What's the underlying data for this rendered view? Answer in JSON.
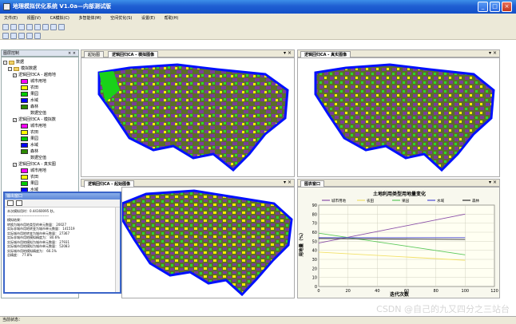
{
  "window": {
    "title": "地理模拟优化系统 V1.0a—内部测试版"
  },
  "menu": [
    "文件(E)",
    "视图(V)",
    "CA模拟(C)",
    "多智能体(M)",
    "空间优化(S)",
    "设置(E)",
    "帮助(H)"
  ],
  "layer_panel": {
    "header": "图层控制",
    "root": "数据",
    "group": "模拟数据",
    "layers": [
      {
        "name": "逻辑回归CA - 越南地"
      },
      {
        "name": "逻辑回归CA - 模拟数"
      },
      {
        "name": "逻辑回归CA - 真实图"
      }
    ],
    "legend": [
      {
        "label": "城市用地",
        "color": "#ff00ff"
      },
      {
        "label": "农田",
        "color": "#ffff00"
      },
      {
        "label": "果园",
        "color": "#00cc00"
      },
      {
        "label": "水域",
        "color": "#0000ff"
      },
      {
        "label": "森林",
        "color": "#2d8a00"
      }
    ],
    "empty_label": "数据空值"
  },
  "output_window": {
    "title": "输出窗口",
    "lines": [
      "本次模拟用时：0.44160095 秒。",
      "------------------------------------",
      "",
      "模拟结果：",
      "",
      "转换为城市用地类型的单元数量： 20027",
      "",
      "实际非城市用地转变为城市单元数量： 141519",
      "实际城市用地转变为城市单元数量： 27367",
      "实际非城市用地模拟精度为： 80.6%",
      "",
      "实际城市用地模拟为城市单元数量： 27931",
      "实际城市用地模拟为城市单元数量： 52083",
      "实际城市用地模拟精度为： 66.1%",
      "",
      "总精度：  77.8%"
    ]
  },
  "panes": {
    "top_left": {
      "tabs": [
        "起始图",
        "逻辑回归CA - 模拟图像"
      ]
    },
    "top_right": {
      "tabs": [
        "逻辑回归CA - 真实图像"
      ]
    },
    "bottom_left": {
      "tabs": [
        "逻辑回归CA - 起始图像"
      ]
    },
    "bottom_right": {
      "tabs": [
        "图表窗口"
      ]
    }
  },
  "chart_data": {
    "type": "line",
    "title": "土地利用类型用地量变化",
    "xlabel": "迭代次数",
    "ylabel": "用地量（%）",
    "xlim": [
      0,
      120
    ],
    "ylim": [
      0,
      90
    ],
    "xticks": [
      0,
      20,
      40,
      60,
      80,
      100,
      120
    ],
    "yticks": [
      0,
      10,
      20,
      30,
      40,
      50,
      60,
      70,
      80,
      90
    ],
    "grid": true,
    "legend": "top",
    "series": [
      {
        "name": "城市用地",
        "color": "#8a4fa8",
        "x": [
          0,
          100
        ],
        "y": [
          48,
          80
        ]
      },
      {
        "name": "农田",
        "color": "#f2e06a",
        "x": [
          0,
          100
        ],
        "y": [
          38,
          29
        ]
      },
      {
        "name": "果园",
        "color": "#5ac85a",
        "x": [
          0,
          100
        ],
        "y": [
          59,
          35
        ]
      },
      {
        "name": "水域",
        "color": "#4a4ad6",
        "x": [
          0,
          100
        ],
        "y": [
          54,
          54
        ]
      },
      {
        "name": "森林",
        "color": "#2d2d2d",
        "x": [
          0,
          100
        ],
        "y": [
          53,
          52
        ]
      }
    ]
  },
  "status": {
    "text": "当前状态："
  },
  "watermark": "CSDN @自己的九又四分之三站台"
}
